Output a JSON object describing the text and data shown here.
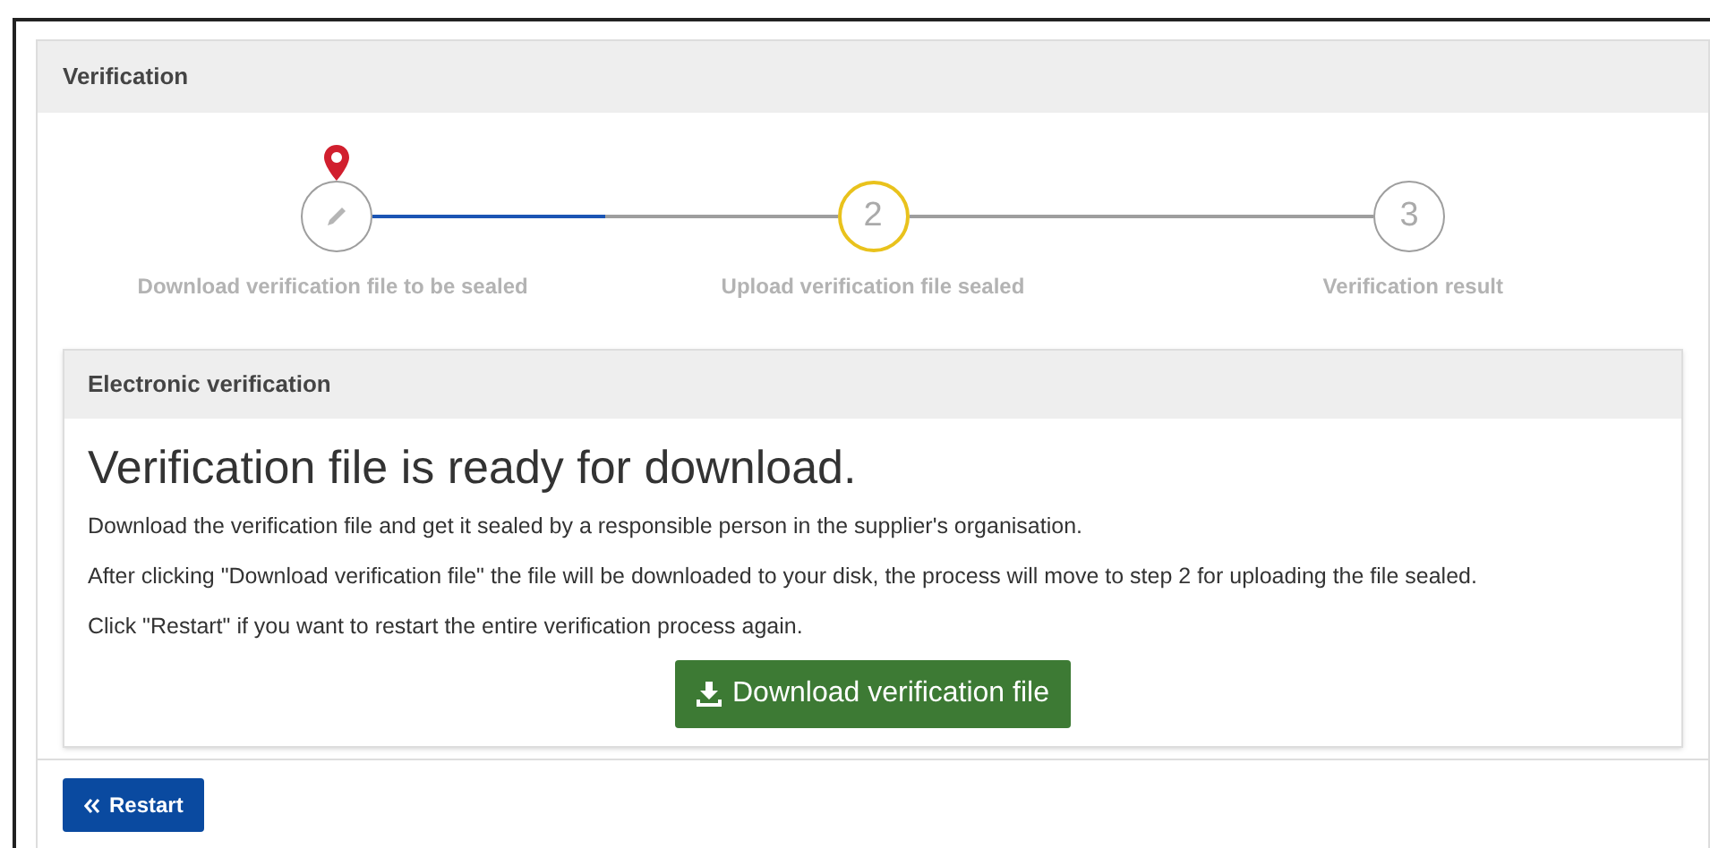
{
  "panel": {
    "title": "Verification"
  },
  "stepper": {
    "steps": [
      {
        "kind": "done",
        "current": true,
        "label": "Download verification file to be sealed"
      },
      {
        "kind": "active",
        "current": false,
        "number": "2",
        "label": "Upload verification file sealed"
      },
      {
        "kind": "pending",
        "current": false,
        "number": "3",
        "label": "Verification result"
      }
    ],
    "connectors": [
      {
        "level": 0.5
      },
      {
        "level": 0
      }
    ]
  },
  "card": {
    "title": "Electronic verification",
    "heading": "Verification file is ready for download.",
    "paragraphs": [
      "Download the verification file and get it sealed by a responsible person in the supplier's organisation.",
      "After clicking \"Download verification file\" the file will be downloaded to your disk, the process will move to step 2 for uploading the file sealed.",
      "Click \"Restart\" if you want to restart the entire verification process again."
    ],
    "download_button": "Download verification file"
  },
  "restart_button": "Restart"
}
